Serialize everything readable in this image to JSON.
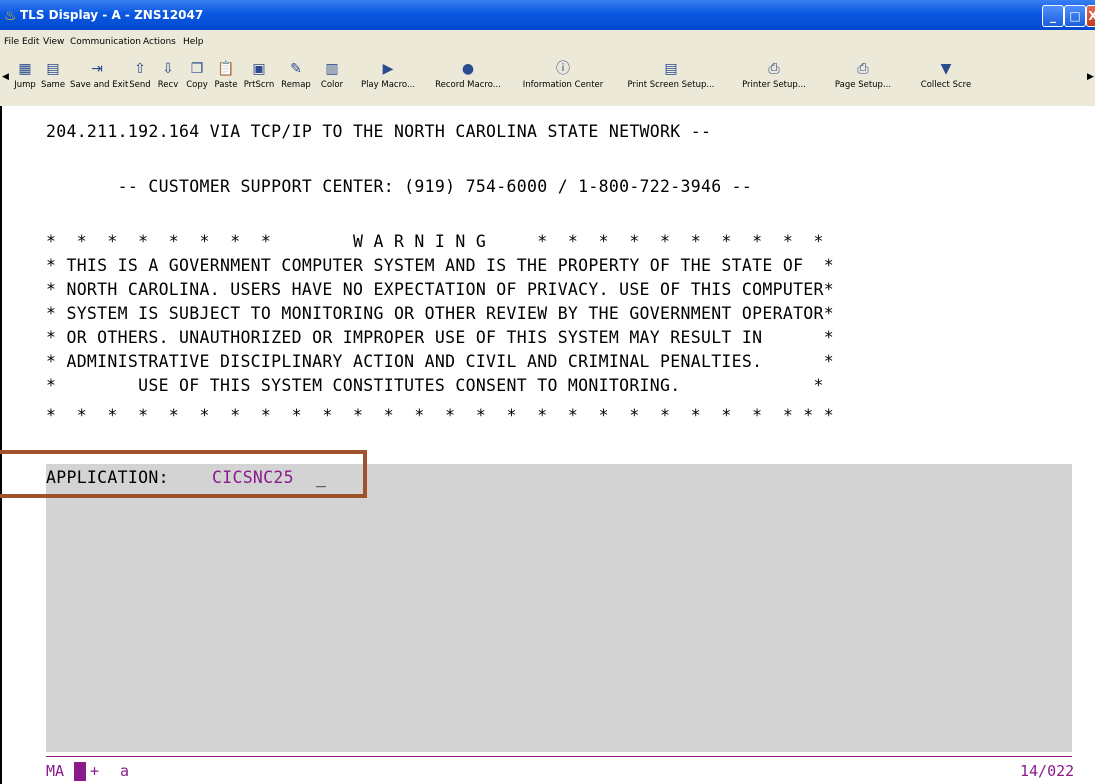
{
  "window": {
    "title": "TLS Display - A - ZNS12047",
    "minimize_label": "_",
    "maximize_label": "□",
    "close_label": "X"
  },
  "menu": [
    "File",
    "Edit",
    "View",
    "Communication",
    "Actions",
    "Help"
  ],
  "toolbar": [
    {
      "label": "Jump",
      "icon": "jump-icon"
    },
    {
      "label": "Same",
      "icon": "same-icon"
    },
    {
      "label": "Save and Exit",
      "icon": "save-exit-icon"
    },
    {
      "label": "Send",
      "icon": "send-icon"
    },
    {
      "label": "Recv",
      "icon": "recv-icon"
    },
    {
      "label": "Copy",
      "icon": "copy-icon"
    },
    {
      "label": "Paste",
      "icon": "paste-icon"
    },
    {
      "label": "PrtScrn",
      "icon": "print-screen-icon"
    },
    {
      "label": "Remap",
      "icon": "remap-icon"
    },
    {
      "label": "Color",
      "icon": "color-icon"
    },
    {
      "label": "Play Macro...",
      "icon": "play-macro-icon"
    },
    {
      "label": "Record Macro...",
      "icon": "record-macro-icon"
    },
    {
      "label": "Information Center",
      "icon": "info-center-icon"
    },
    {
      "label": "Print Screen Setup...",
      "icon": "print-screen-setup-icon"
    },
    {
      "label": "Printer Setup...",
      "icon": "printer-setup-icon"
    },
    {
      "label": "Page Setup...",
      "icon": "page-setup-icon"
    },
    {
      "label": "Collect Scre",
      "icon": "collect-screen-icon"
    }
  ],
  "terminal": {
    "lines": [
      "204.211.192.164 VIA TCP/IP TO THE NORTH CAROLINA STATE NETWORK --",
      "       -- CUSTOMER SUPPORT CENTER: (919) 754-6000 / 1-800-722-3946 --",
      "*  *  *  *  *  *  *  *        W A R N I N G     *  *  *  *  *  *  *  *  *  *",
      "* THIS IS A GOVERNMENT COMPUTER SYSTEM AND IS THE PROPERTY OF THE STATE OF  *",
      "* NORTH CAROLINA. USERS HAVE NO EXPECTATION OF PRIVACY. USE OF THIS COMPUTER*",
      "* SYSTEM IS SUBJECT TO MONITORING OR OTHER REVIEW BY THE GOVERNMENT OPERATOR*",
      "* OR OTHERS. UNAUTHORIZED OR IMPROPER USE OF THIS SYSTEM MAY RESULT IN      *",
      "* ADMINISTRATIVE DISCIPLINARY ACTION AND CIVIL AND CRIMINAL PENALTIES.      *",
      "*        USE OF THIS SYSTEM CONSTITUTES CONSENT TO MONITORING.             *",
      "*  *  *  *  *  *  *  *  *  *  *  *  *  *  *  *  *  *  *  *  *  *  *  *  * * *"
    ],
    "application_label": "APPLICATION:",
    "application_value": "CICSNC25",
    "cursor": "_"
  },
  "status": {
    "mode": "MA",
    "indicator": "+",
    "insert": "a",
    "cursor_position": "14/022"
  },
  "colors": {
    "highlight_border": "#a0522d",
    "input_text": "#8b1a8b"
  }
}
